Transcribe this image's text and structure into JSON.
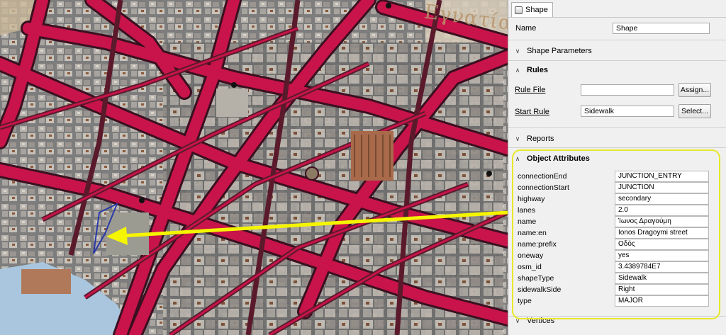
{
  "map": {
    "label": "Εγνατία",
    "arrow_color": "#f5f500"
  },
  "panel": {
    "tab_label": "Shape",
    "name_label": "Name",
    "name_value": "Shape",
    "shape_parameters": "Shape Parameters",
    "rules": {
      "title": "Rules",
      "rule_file_label": "Rule File",
      "rule_file_value": "",
      "assign_button": "Assign...",
      "start_rule_label": "Start Rule",
      "start_rule_value": "Sidewalk",
      "select_button": "Select..."
    },
    "reports": "Reports",
    "object_attributes": {
      "title": "Object Attributes",
      "rows": [
        {
          "key": "connectionEnd",
          "value": "JUNCTION_ENTRY"
        },
        {
          "key": "connectionStart",
          "value": "JUNCTION"
        },
        {
          "key": "highway",
          "value": "secondary"
        },
        {
          "key": "lanes",
          "value": "2.0"
        },
        {
          "key": "name",
          "value": "Ίωνος Δραγούμη"
        },
        {
          "key": "name:en",
          "value": "Ionos Dragoymi street"
        },
        {
          "key": "name:prefix",
          "value": "Οδός"
        },
        {
          "key": "oneway",
          "value": "yes"
        },
        {
          "key": "osm_id",
          "value": "3.4389784E7"
        },
        {
          "key": "shapeType",
          "value": "Sidewalk"
        },
        {
          "key": "sidewalkSide",
          "value": "Right"
        },
        {
          "key": "type",
          "value": "MAJOR"
        }
      ]
    },
    "vertices": "Vertices"
  },
  "colors": {
    "road": "#c8144a",
    "road_edge": "#3a1020",
    "block": "#8a8a8a",
    "sea": "#a9c6de",
    "highlight": "#e8e82a"
  }
}
